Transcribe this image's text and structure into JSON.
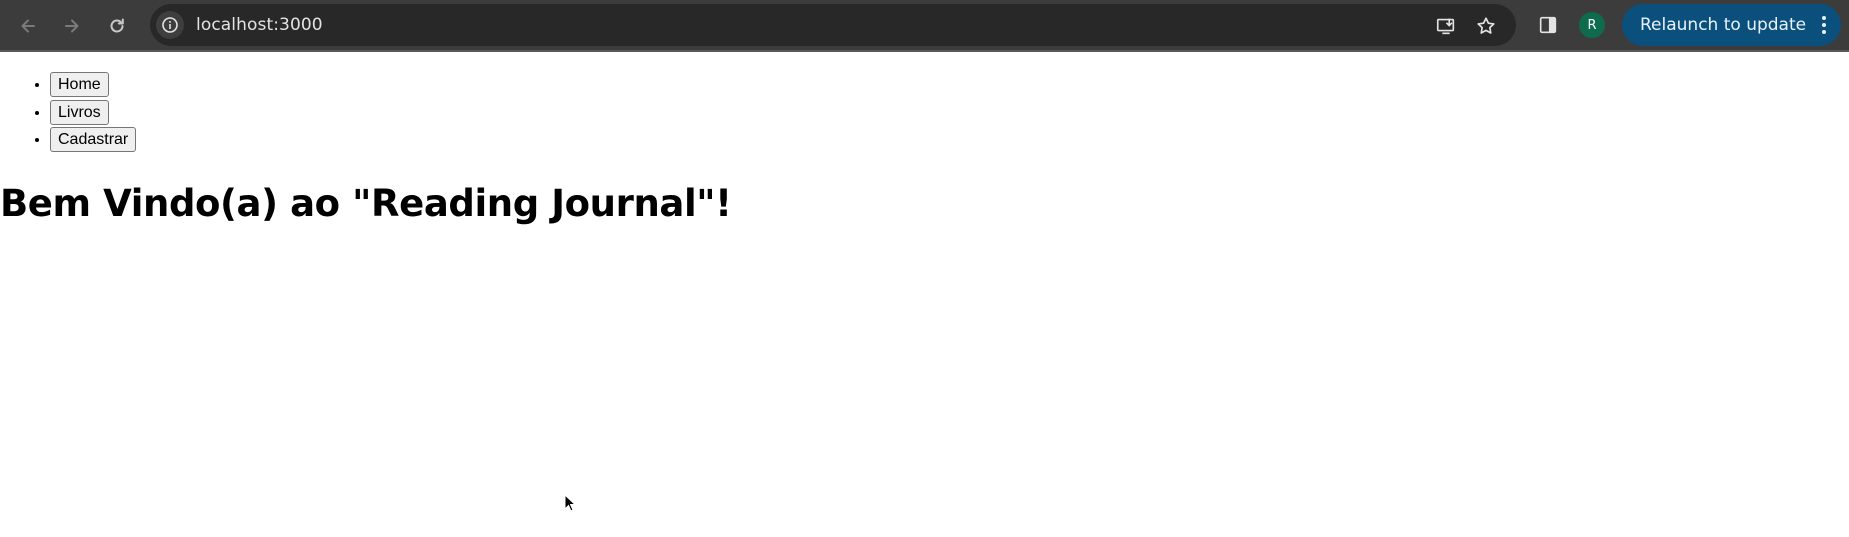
{
  "browser": {
    "url": "localhost:3000",
    "profile_initial": "R",
    "relaunch_label": "Relaunch to update",
    "icons": {
      "back": "arrow-left-icon",
      "forward": "arrow-right-icon",
      "reload": "reload-icon",
      "site_info": "info-icon",
      "install": "install-app-icon",
      "bookmark": "star-icon",
      "side_panel": "side-panel-icon",
      "menu": "kebab-menu-icon"
    },
    "colors": {
      "toolbar": "#3c3c3c",
      "omnibox": "#282828",
      "relaunch": "#0b4f7c",
      "avatar": "#0e6b4e"
    }
  },
  "page": {
    "nav": [
      {
        "label": "Home"
      },
      {
        "label": "Livros"
      },
      {
        "label": "Cadastrar"
      }
    ],
    "heading": "Bem Vindo(a) ao \"Reading Journal\"!"
  }
}
